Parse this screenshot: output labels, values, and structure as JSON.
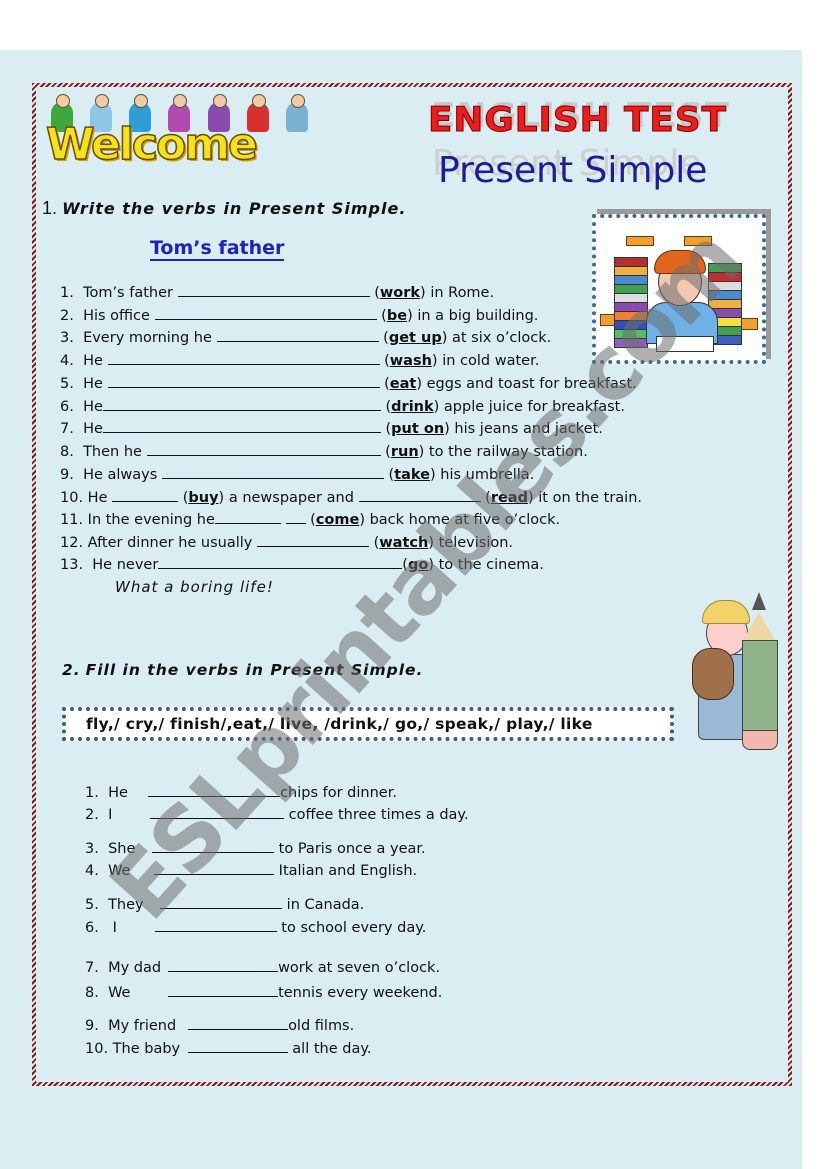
{
  "header": {
    "banner_text": "Welcome",
    "title": "ENGLISH TEST",
    "subtitle": "Present Simple"
  },
  "colors": {
    "title_red": "#ee1c1c",
    "subtitle_blue": "#1d1b9a",
    "link_blue": "#1a22c0",
    "page_bg": "#daedf2",
    "frame": "#7a1e24",
    "dotted_border": "#3b5b8a"
  },
  "section1": {
    "number": "1.",
    "instruction": "Write the verbs in Present Simple.",
    "story_title": "Tom’s father",
    "items": [
      {
        "n": "1.",
        "before": "Tom’s father",
        "verb": "work",
        "after": "in Rome."
      },
      {
        "n": "2.",
        "before": "His office",
        "verb": "be",
        "after": "in a big building."
      },
      {
        "n": "3.",
        "before": "Every morning he",
        "verb": "get  up",
        "after": "at six o’clock."
      },
      {
        "n": "4.",
        "before": "He",
        "verb": "wash",
        "after": "in cold water."
      },
      {
        "n": "5.",
        "before": "He",
        "verb": "eat",
        "after": "eggs and toast for breakfast."
      },
      {
        "n": "6.",
        "before": "He",
        "verb": "drink",
        "after": "apple juice for breakfast."
      },
      {
        "n": "7.",
        "before": "He",
        "verb": "put  on",
        "after": "his jeans and jacket."
      },
      {
        "n": "8.",
        "before": "Then he",
        "verb": "run",
        "after": "to the railway station."
      },
      {
        "n": "9.",
        "before": "He always",
        "verb": "take",
        "after": "his umbrella."
      },
      {
        "n": "10.",
        "before": "He",
        "verb": "buy",
        "middle": "a newspaper and",
        "verb2": "read",
        "after": "it on the train."
      },
      {
        "n": "11.",
        "before": "In the evening he",
        "verb": "come",
        "after": "back home at five o’clock."
      },
      {
        "n": "12.",
        "before": "After dinner he usually",
        "verb": "watch",
        "after": "television."
      },
      {
        "n": "13.",
        "before": "He never",
        "verb": "go",
        "after": "to the cinema."
      }
    ],
    "closing": "What a boring life!"
  },
  "section2": {
    "number": "2.",
    "instruction": "Fill in the verbs in Present Simple.",
    "verb_bank": "fly,/ cry,/ finish/,eat,/ live, /drink,/ go,/ speak,/ play,/ like",
    "items": [
      {
        "n": "1.",
        "subject": "He",
        "after": "chips for dinner."
      },
      {
        "n": "2.",
        "subject": "I",
        "after": "coffee three times a day."
      },
      {
        "n": "3.",
        "subject": "She",
        "after": "to Paris once a year."
      },
      {
        "n": "4.",
        "subject": "We",
        "after": "Italian and English."
      },
      {
        "n": "5.",
        "subject": "They",
        "after": "in Canada."
      },
      {
        "n": "6.",
        "subject": "I",
        "after": "to school every day."
      },
      {
        "n": "7.",
        "subject": "My dad",
        "after": "work at seven o’clock."
      },
      {
        "n": "8.",
        "subject": "We",
        "after": "tennis every weekend."
      },
      {
        "n": "9.",
        "subject": "My friend",
        "after": "old films."
      },
      {
        "n": "10.",
        "subject": "The baby",
        "after": "all the day."
      }
    ]
  },
  "images": {
    "welcome_banner": "welcome-kids-illustration",
    "student_with_books": "bored-student-books-illustration",
    "child_with_pencil": "child-teddy-pencil-illustration"
  },
  "watermark": "ESLprintables.com"
}
